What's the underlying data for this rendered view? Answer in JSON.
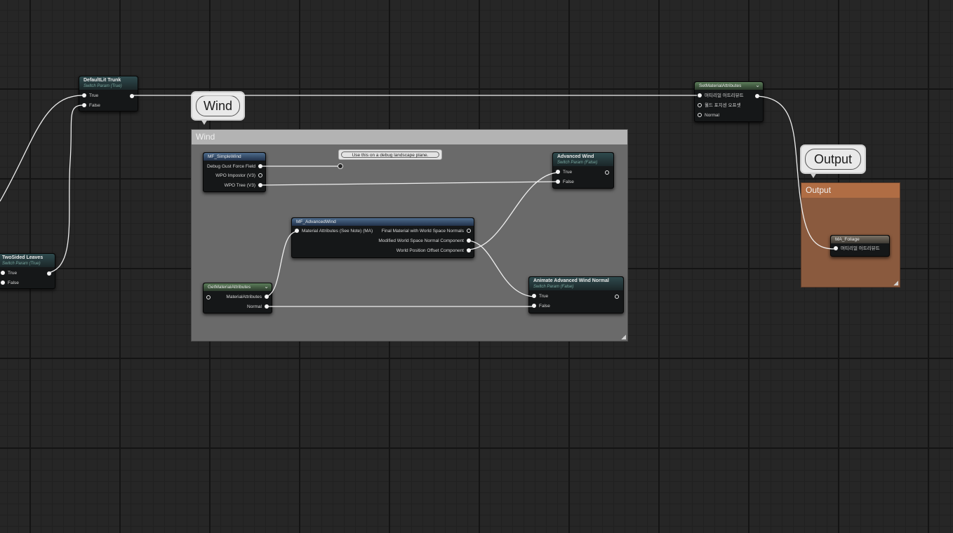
{
  "comments": {
    "wind": {
      "title": "Wind",
      "bubble": "Wind"
    },
    "output": {
      "title": "Output",
      "bubble": "Output"
    }
  },
  "nodes": {
    "defaultlit_trunk": {
      "title": "DefaultLit Trunk",
      "subtitle": "Switch Param (True)",
      "pins": [
        "True",
        "False"
      ]
    },
    "twosided_leaves": {
      "title": "TwoSided Leaves",
      "subtitle": "Switch Param (True)",
      "pins": [
        "True",
        "False"
      ]
    },
    "set_material_attributes": {
      "title": "SetMaterialAttributes",
      "pins": [
        "머티리얼 어트리뷰트",
        "월드 포지션 오프셋",
        "Normal"
      ]
    },
    "mf_simplewind": {
      "title": "MF_SimpleWind",
      "pins": [
        "Debug Gust Force Field",
        "WPO Impostor (V3)",
        "WPO Tree (V3)"
      ]
    },
    "debug_comment": {
      "text": "Use this on a debug landscape plane."
    },
    "advanced_wind": {
      "title": "Advanced Wind",
      "subtitle": "Switch Param (False)",
      "pins": [
        "True",
        "False"
      ]
    },
    "mf_advancedwind": {
      "title": "MF_AdvancedWind",
      "input": "Material Attributes (See Note) (MA)",
      "outputs": [
        "Final Material with World Space Normals",
        "Modified World Space Normal Component",
        "World Position Offset Component"
      ]
    },
    "get_material_attributes": {
      "title": "GetMaterialAttributes",
      "pins": [
        "MaterialAttributes",
        "Normal"
      ]
    },
    "animate_advanced_wind_normal": {
      "title": "Animate Advanced Wind Normal",
      "subtitle": "Switch Param (False)",
      "pins": [
        "True",
        "False"
      ]
    },
    "ma_foliage": {
      "title": "MA_Foliage",
      "pins": [
        "머티리얼 어트리뷰트"
      ]
    }
  },
  "colors": {
    "grid_background": "#262626",
    "wind_comment": "#6a6a6a",
    "output_comment": "#8a5a3e",
    "wire": "#f0f0f0"
  },
  "icons": [
    "chevron-down-icon",
    "resize-grip-icon",
    "pin-icon"
  ]
}
